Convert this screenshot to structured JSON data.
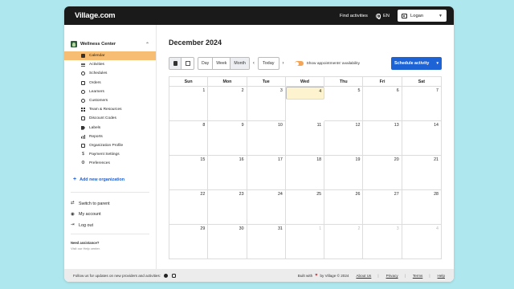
{
  "app": {
    "logo": "Village.com",
    "find_activities": "Find activities",
    "language": "EN",
    "user": "Logan"
  },
  "sidebar": {
    "org_name": "Wellness Center",
    "items": [
      {
        "label": "Calendar",
        "icon": "calendar-icon"
      },
      {
        "label": "Activities",
        "icon": "activities-icon"
      },
      {
        "label": "Schedules",
        "icon": "clock-icon"
      },
      {
        "label": "Orders",
        "icon": "orders-icon"
      },
      {
        "label": "Learners",
        "icon": "learners-icon"
      },
      {
        "label": "Customers",
        "icon": "customers-icon"
      },
      {
        "label": "Team & Resources",
        "icon": "team-icon"
      },
      {
        "label": "Discount Codes",
        "icon": "discount-icon"
      },
      {
        "label": "Labels",
        "icon": "tag-icon"
      },
      {
        "label": "Reports",
        "icon": "bar-chart-icon"
      },
      {
        "label": "Organization Profile",
        "icon": "profile-icon"
      },
      {
        "label": "Payment Settings",
        "icon": "dollar-icon"
      },
      {
        "label": "Preferences",
        "icon": "gear-icon"
      }
    ],
    "add_org": "Add new organization",
    "switch_parent": "Switch to parent",
    "my_account": "My account",
    "log_out": "Log out",
    "need_assistance": "Need assistance?",
    "help_text": "Visit our Help center."
  },
  "calendar": {
    "title": "December 2024",
    "views": [
      "Day",
      "Week",
      "Month"
    ],
    "selected_view": "Month",
    "today": "Today",
    "toggle_label": "Show appointments' availability",
    "schedule_btn": "Schedule activity",
    "weekdays": [
      "Sun",
      "Mon",
      "Tue",
      "Wed",
      "Thu",
      "Fri",
      "Sat"
    ],
    "weeks": [
      [
        "1",
        "2",
        "3",
        "4",
        "5",
        "6",
        "7"
      ],
      [
        "8",
        "9",
        "10",
        "11",
        "12",
        "13",
        "14"
      ],
      [
        "15",
        "16",
        "17",
        "18",
        "19",
        "20",
        "21"
      ],
      [
        "22",
        "23",
        "24",
        "25",
        "26",
        "27",
        "28"
      ],
      [
        "29",
        "30",
        "31",
        "1",
        "2",
        "3",
        "4"
      ]
    ],
    "today_date": "4"
  },
  "footer": {
    "follow": "Follow us for updates on new providers and activities:",
    "built_prefix": "Built with",
    "built_suffix": "by Village © 2024",
    "about": "About Us",
    "privacy": "Privacy",
    "terms": "Terms",
    "help": "Help"
  }
}
